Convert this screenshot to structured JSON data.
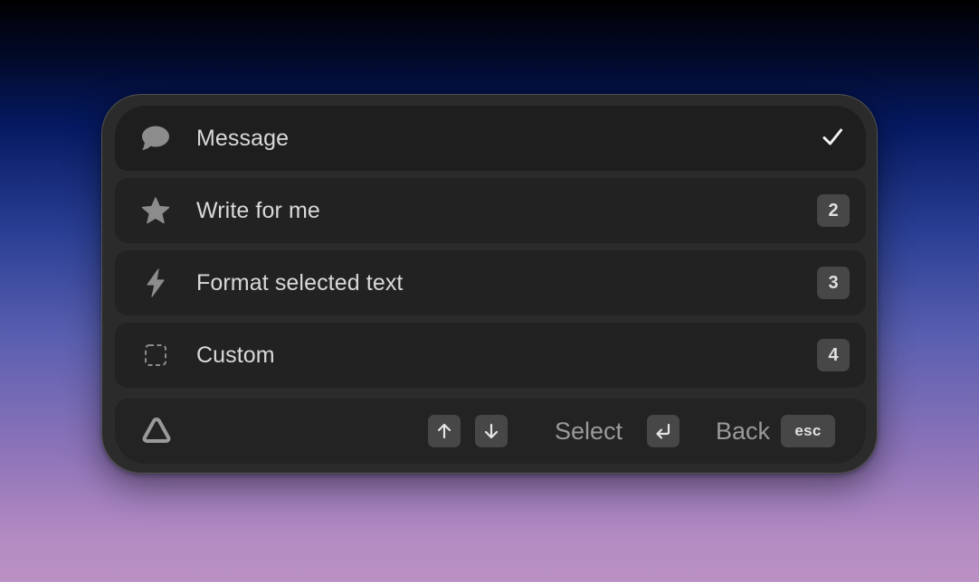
{
  "menu": {
    "items": [
      {
        "label": "Message",
        "icon": "chat-bubble-icon",
        "state": "selected"
      },
      {
        "label": "Write for me",
        "icon": "star-icon",
        "shortcut": "2"
      },
      {
        "label": "Format selected text",
        "icon": "lightning-icon",
        "shortcut": "3"
      },
      {
        "label": "Custom",
        "icon": "dashed-square-icon",
        "shortcut": "4"
      }
    ]
  },
  "footer": {
    "logo_icon": "triangle-logo-icon",
    "nav_icons": [
      "arrow-up-icon",
      "arrow-down-icon"
    ],
    "select_label": "Select",
    "select_icon": "return-key-icon",
    "back_label": "Back",
    "back_key": "esc"
  },
  "colors": {
    "panel": "#2b2b2b",
    "row": "#222222",
    "keycap": "#474747",
    "text": "#d9d9d9",
    "muted_text": "#9a9a9a",
    "icon": "#8c8c8c"
  }
}
